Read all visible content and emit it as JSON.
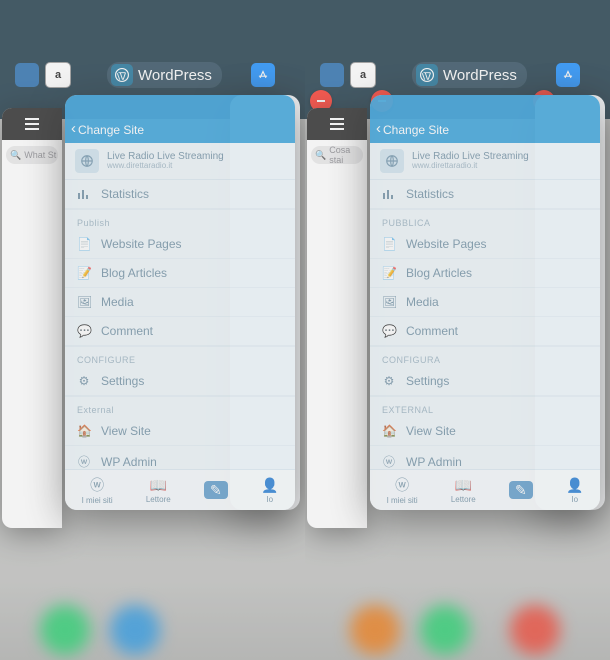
{
  "top": {
    "wp_label": "WordPress"
  },
  "left": {
    "bg_search_placeholder": "What St",
    "header_back": "Change Site",
    "site_title": "Live Radio Live Streaming",
    "site_url": "www.direttaradio.it",
    "stats": "Statistics",
    "sections": {
      "publish": "Publish",
      "configure": "CONFIGURE",
      "external": "External"
    },
    "rows": {
      "pages": "Website Pages",
      "posts": "Blog Articles",
      "media": "Media",
      "comments": "Comment",
      "settings": "Settings",
      "view_site": "View Site",
      "wp_admin": "WP Admin"
    },
    "tabs": {
      "my_sites": "I miei siti",
      "reader": "Lettore",
      "me": "Io"
    }
  },
  "right": {
    "bg_search_placeholder": "Cosa stai",
    "header_back": "Change Site",
    "site_title": "Live Radio Live Streaming",
    "site_url": "www.direttaradio.it",
    "stats": "Statistics",
    "sections": {
      "publish": "PUBBLICA",
      "configure": "CONFIGURA",
      "external": "EXTERNAL"
    },
    "rows": {
      "pages": "Website Pages",
      "posts": "Blog Articles",
      "media": "Media",
      "comments": "Comment",
      "settings": "Settings",
      "view_site": "View Site",
      "wp_admin": "WP Admin"
    },
    "tabs": {
      "my_sites": "I miei siti",
      "reader": "Lettore",
      "me": "Io"
    }
  }
}
